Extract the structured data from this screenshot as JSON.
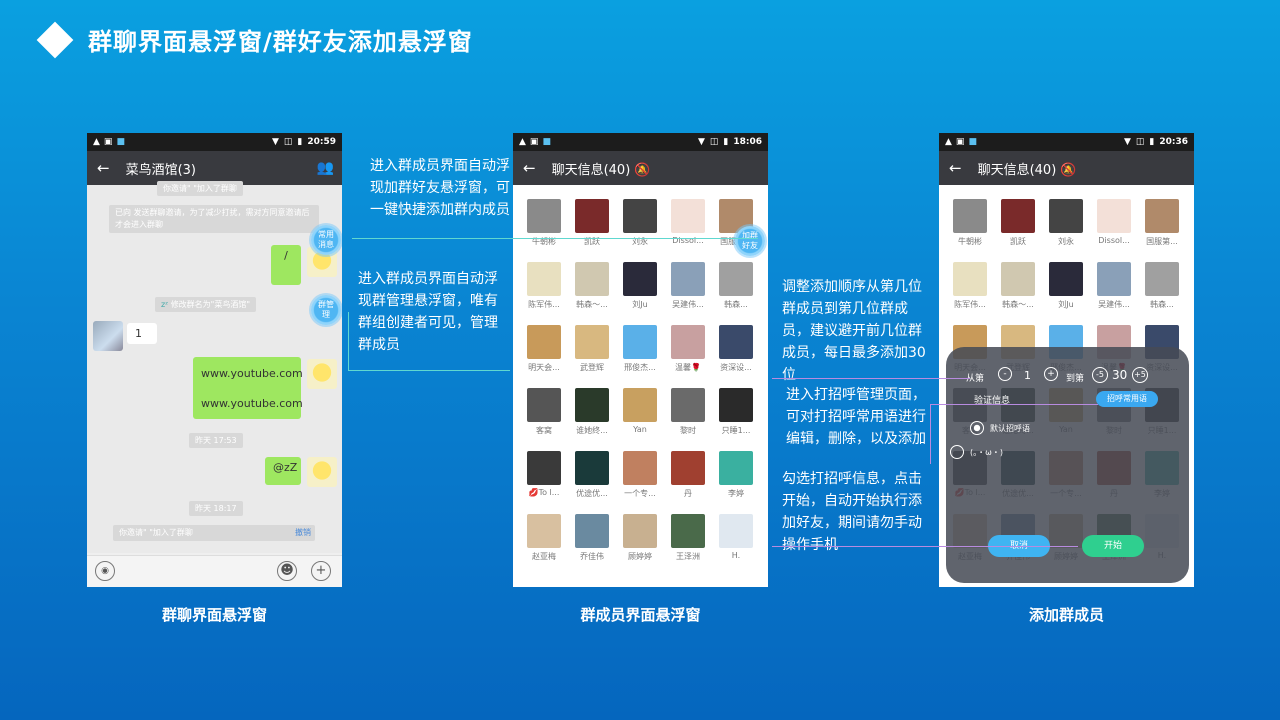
{
  "title": "群聊界面悬浮窗/群好友添加悬浮窗",
  "captions": [
    "群聊界面悬浮窗",
    "群成员界面悬浮窗",
    "添加群成员"
  ],
  "annotations": {
    "a1": "进入群成员界面自动浮现加群好友悬浮窗，可一键快捷添加群内成员",
    "a2": "进入群成员界面自动浮现群管理悬浮窗，唯有群组创建者可见，管理群成员",
    "a3": "调整添加顺序从第几位群成员到第几位群成员，建议避开前几位群成员，每日最多添加30位",
    "a4": "进入打招呼管理页面，可对打招呼常用语进行编辑，删除，以及添加",
    "a5": "勾选打招呼信息，点击开始，自动开始执行添加好友，期间请勿手动操作手机"
  },
  "phone1": {
    "time": "20:59",
    "header": "菜鸟酒馆(3)",
    "sys_top": "你邀请\"       \"加入了群聊",
    "sys_invite": "已向                    发送群聊邀请，为了减少打扰，需对方同意邀请后才会进入群聊",
    "msg1": "/",
    "float1": "常用\n消息",
    "float2": "群管\n理",
    "sys_rename": "修改群名为\"菜鸟酒馆\"",
    "msg_in": "1",
    "link1": "www.youtube.com",
    "link2": "www.youtube.com",
    "time1": "昨天 17:53",
    "msg3": "@zZ",
    "time2": "昨天 18:17",
    "sys_bottom": "你邀请\"            \"加入了群聊",
    "undo": "撤销"
  },
  "phone2": {
    "time": "18:06",
    "header": "聊天信息(40)",
    "float": "加群\n好友",
    "members": [
      "牛朝彬",
      "凯跃",
      "刘永",
      "Dissol...",
      "国服第...",
      "陈军伟...",
      "韩森～...",
      "刘Ju",
      "吴建伟...",
      "韩森...",
      "明天会...",
      "武登辉",
      "邢俊杰...",
      "温馨🌹",
      "资深设...",
      "客窝",
      "谁她终...",
      "Yan",
      "黎时",
      "只睡1...",
      "💋To l...",
      "优途优...",
      "一个专...",
      "丹",
      "李婷",
      "赵亚梅",
      "乔佳伟",
      "顾婷婷",
      "王泽洲",
      "H."
    ]
  },
  "phone3": {
    "time": "20:36",
    "header": "聊天信息(40)",
    "members": [
      "牛朝彬",
      "凯跃",
      "刘永",
      "Dissol...",
      "国服第...",
      "陈军伟...",
      "韩森～...",
      "刘Ju",
      "吴建伟...",
      "韩森...",
      "明天会...",
      "武登辉",
      "邢俊杰...",
      "温馨🌹",
      "资深设...",
      "客窝",
      "谁她终...",
      "Yan",
      "黎时",
      "只睡1...",
      "💋To l...",
      "优途优...",
      "一个专...",
      "丹",
      "李婷",
      "赵亚梅",
      "乔佳伟",
      "顾婷婷",
      "王泽洲",
      "H."
    ],
    "from_label": "从第",
    "from_value": "1",
    "to_label": "到第",
    "to_value": "30",
    "minus5": "-5",
    "plus5": "+5",
    "verify_label": "验证信息",
    "greet_btn": "招呼常用语",
    "opt1": "默认招呼语",
    "opt2": "(。・ω・)",
    "cancel": "取消",
    "start": "开始"
  }
}
